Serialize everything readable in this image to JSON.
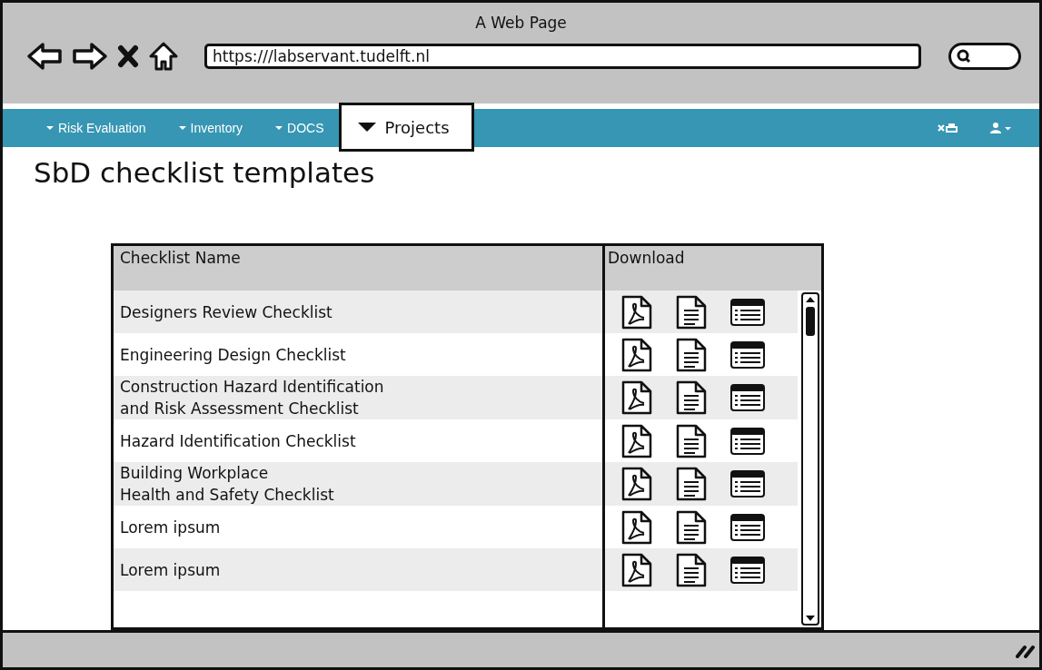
{
  "window": {
    "title": "A Web Page"
  },
  "address_bar": {
    "value": "https:///labservant.tudelft.nl"
  },
  "nav": [
    {
      "label": "Risk Evaluation",
      "selected": false
    },
    {
      "label": "Inventory",
      "selected": false
    },
    {
      "label": "DOCS",
      "selected": false
    },
    {
      "label": "Projects",
      "selected": true
    }
  ],
  "page_title": "SbD checklist templates",
  "table": {
    "columns": [
      "Checklist Name",
      "Download"
    ],
    "rows": [
      {
        "name": "Designers Review Checklist"
      },
      {
        "name": "Engineering Design Checklist"
      },
      {
        "name": "Construction Hazard Identification\nand Risk Assessment Checklist"
      },
      {
        "name": "Hazard Identification Checklist"
      },
      {
        "name": "Building Workplace\nHealth and Safety Checklist"
      },
      {
        "name": "Lorem ipsum"
      },
      {
        "name": "Lorem ipsum"
      }
    ]
  }
}
